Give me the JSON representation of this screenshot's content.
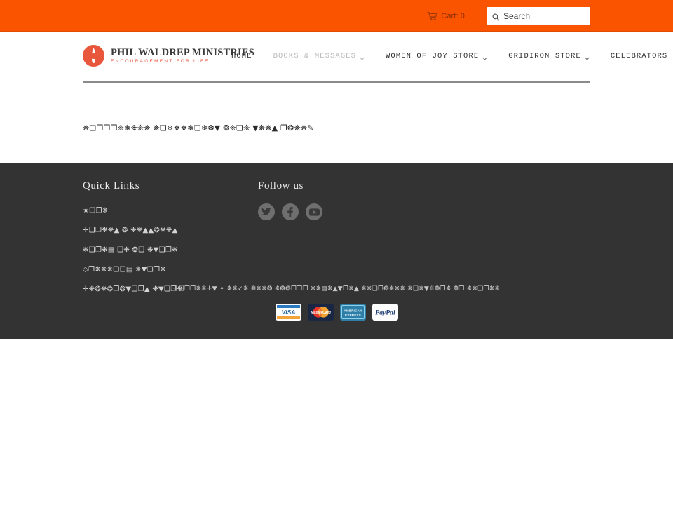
{
  "topbar": {
    "background_color": "#fa5400",
    "cart": {
      "icon": "shopping-cart-icon",
      "label": "Cart: 0"
    },
    "search": {
      "icon": "search-icon",
      "value": "",
      "placeholder": "Search"
    }
  },
  "header": {
    "logo": {
      "mark": "flame-logo-icon",
      "title": "PHIL WALDREP MINISTRIES",
      "tagline": "ENCOURAGEMENT FOR LIFE",
      "accent_color": "#e8563b"
    },
    "nav": [
      {
        "label": "HOME",
        "has_caret": false,
        "muted": false
      },
      {
        "label": "BOOKS & MESSAGES",
        "has_caret": true,
        "muted": true
      },
      {
        "label": "WOMEN OF JOY STORE",
        "has_caret": true,
        "muted": false
      },
      {
        "label": "GRIDIRON STORE",
        "has_caret": true,
        "muted": false
      },
      {
        "label": "CELEBRATORS STORE",
        "has_caret": false,
        "muted": false
      }
    ]
  },
  "main": {
    "body_text": "❋❑❐❒❒❉❃❉❊❋ ❋❑❄❖❖❃❏❄❆▼ ❂❉❏❊ ▼❋❋▲ ❐❂❋❋✎"
  },
  "footer": {
    "background_color": "#333333",
    "quick_links": {
      "heading": "Quick Links",
      "items": [
        "★❑❐❋",
        "✛❑❐❋❋▲ ❂ ❋❋▲▲❂❋❋▲",
        "❋❑❐❋▤ ❑❋ ❂❑ ❋▼❑❐❋",
        "◇❐❋❋❋❑❑▤ ❋▼❑❐❋",
        "✛❋❂❋❂❐❂▼❑❐▲ ❋▼❑❐❋"
      ]
    },
    "follow": {
      "heading": "Follow us",
      "socials": [
        {
          "name": "twitter-icon",
          "label": "Twitter"
        },
        {
          "name": "facebook-icon",
          "label": "Facebook"
        },
        {
          "name": "youtube-icon",
          "label": "YouTube"
        }
      ]
    },
    "copyright": "✛❑❐❐❋❋✛▼ ✦ ❋❋✓❋ ❁❋❋❂ ❋❂❂❐❐❐ ❋❋▤❋▲▼❐❋▲ ❋❋❑❐❂❋❋❋ ❋❑❋▼❊❂❐❋ ❂❐ ❋❋❑❐❋❋",
    "payments": [
      {
        "name": "visa-icon",
        "label": "VISA"
      },
      {
        "name": "mastercard-icon",
        "label": "MasterCard"
      },
      {
        "name": "amex-icon",
        "label": "AMERICAN EXPRESS"
      },
      {
        "name": "paypal-icon",
        "label": "PayPal"
      }
    ]
  }
}
